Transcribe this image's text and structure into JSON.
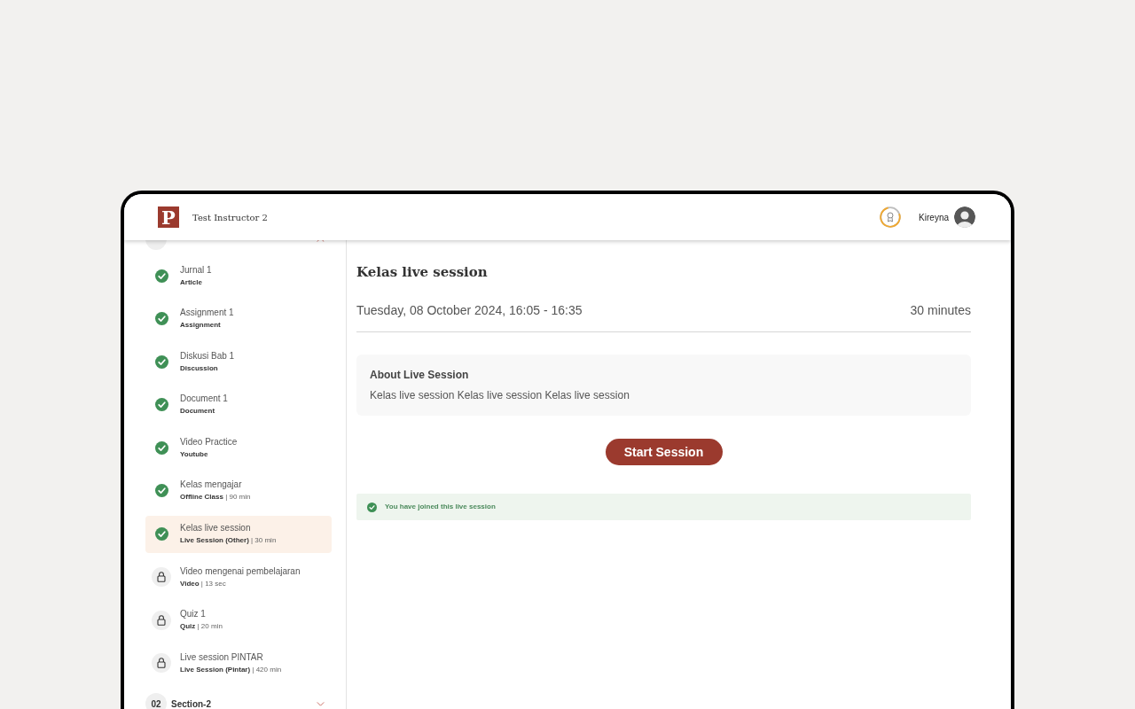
{
  "header": {
    "logo": "P",
    "title": "Test Instructor 2",
    "user": "Kireyna"
  },
  "sidebar": {
    "sections": [
      {
        "expanded": true,
        "items": [
          {
            "title": "Jurnal 1",
            "type": "Article",
            "completed": true,
            "selected": false
          },
          {
            "title": "Assignment 1",
            "type": "Assignment",
            "completed": true,
            "selected": false
          },
          {
            "title": "Diskusi Bab 1",
            "type": "Discussion",
            "completed": true,
            "selected": false
          },
          {
            "title": "Document 1",
            "type": "Document",
            "completed": true,
            "selected": false
          },
          {
            "title": "Video Practice",
            "type": "Youtube",
            "completed": true,
            "selected": false
          },
          {
            "title": "Kelas mengajar",
            "type": "Offline Class",
            "duration": "| 90 min",
            "completed": true,
            "selected": false
          },
          {
            "title": "Kelas live session",
            "type": "Live Session (Other)",
            "duration": "| 30 min",
            "completed": true,
            "selected": true
          },
          {
            "title": "Video mengenai pembelajaran",
            "type": "Video",
            "duration": "| 13 sec",
            "completed": false,
            "selected": false
          },
          {
            "title": "Quiz 1",
            "type": "Quiz",
            "duration": "| 20 min",
            "completed": false,
            "selected": false
          },
          {
            "title": "Live session PINTAR",
            "type": "Live Session (Pintar)",
            "duration": "| 420 min",
            "completed": false,
            "selected": false
          }
        ]
      },
      {
        "number": "02",
        "title": "Section-2",
        "expanded": false
      }
    ]
  },
  "content": {
    "title": "Kelas live session",
    "schedule": "Tuesday, 08 October 2024, 16:05 - 16:35",
    "duration": "30 minutes",
    "about": {
      "title": "About Live Session",
      "text": "Kelas live session Kelas live session Kelas live session"
    },
    "button": "Start Session",
    "notice": "You have joined this live session"
  }
}
